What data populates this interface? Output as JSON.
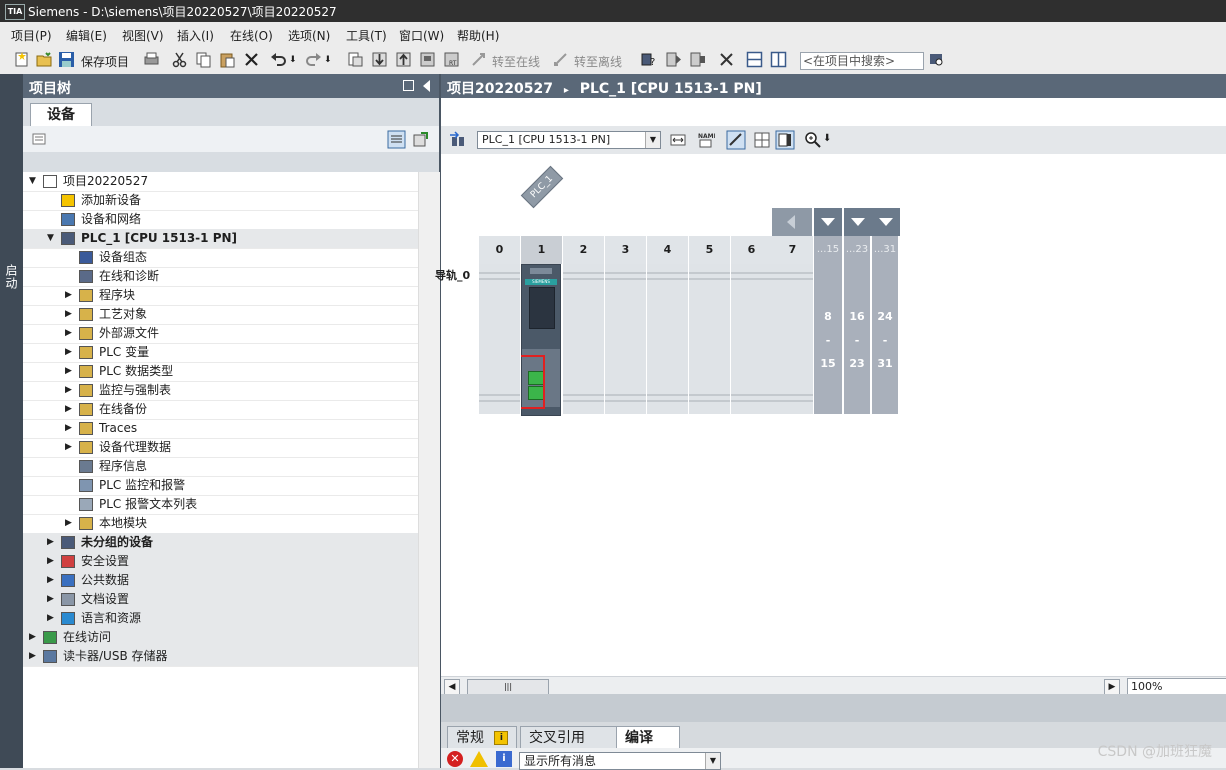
{
  "app": {
    "title": "Siemens  -  D:\\siemens\\项目20220527\\项目20220527",
    "logo": "TIA"
  },
  "menu": [
    "项目(P)",
    "编辑(E)",
    "视图(V)",
    "插入(I)",
    "在线(O)",
    "选项(N)",
    "工具(T)",
    "窗口(W)",
    "帮助(H)"
  ],
  "toolbar": {
    "save_label": "保存项目",
    "go_online": "转至在线",
    "go_offline": "转至离线",
    "search_placeholder": "<在项目中搜索>"
  },
  "startbar": {
    "label": "启动"
  },
  "tree": {
    "header": "项目树",
    "tab": "设备",
    "items": [
      {
        "label": "项目20220527",
        "level": 0,
        "arrow": "down",
        "icon": "document-icon"
      },
      {
        "label": "添加新设备",
        "level": 1,
        "arrow": "",
        "icon": "add-device-icon"
      },
      {
        "label": "设备和网络",
        "level": 1,
        "arrow": "",
        "icon": "network-icon"
      },
      {
        "label": "PLC_1 [CPU 1513-1 PN]",
        "level": 1,
        "arrow": "down",
        "icon": "plc-icon",
        "bold": true,
        "selected": true
      },
      {
        "label": "设备组态",
        "level": 2,
        "arrow": "",
        "icon": "device-config-icon"
      },
      {
        "label": "在线和诊断",
        "level": 2,
        "arrow": "",
        "icon": "diagnostics-icon"
      },
      {
        "label": "程序块",
        "level": 2,
        "arrow": "right",
        "icon": "folder-icon"
      },
      {
        "label": "工艺对象",
        "level": 2,
        "arrow": "right",
        "icon": "folder-icon"
      },
      {
        "label": "外部源文件",
        "level": 2,
        "arrow": "right",
        "icon": "folder-icon"
      },
      {
        "label": "PLC 变量",
        "level": 2,
        "arrow": "right",
        "icon": "folder-icon"
      },
      {
        "label": "PLC 数据类型",
        "level": 2,
        "arrow": "right",
        "icon": "folder-icon"
      },
      {
        "label": "监控与强制表",
        "level": 2,
        "arrow": "right",
        "icon": "folder-icon"
      },
      {
        "label": "在线备份",
        "level": 2,
        "arrow": "right",
        "icon": "folder-icon"
      },
      {
        "label": "Traces",
        "level": 2,
        "arrow": "right",
        "icon": "folder-icon"
      },
      {
        "label": "设备代理数据",
        "level": 2,
        "arrow": "right",
        "icon": "folder-icon"
      },
      {
        "label": "程序信息",
        "level": 2,
        "arrow": "",
        "icon": "program-info-icon"
      },
      {
        "label": "PLC 监控和报警",
        "level": 2,
        "arrow": "",
        "icon": "alarm-icon"
      },
      {
        "label": "PLC 报警文本列表",
        "level": 2,
        "arrow": "",
        "icon": "text-list-icon"
      },
      {
        "label": "本地模块",
        "level": 2,
        "arrow": "right",
        "icon": "folder-icon"
      },
      {
        "label": "未分组的设备",
        "level": 1,
        "arrow": "right",
        "icon": "ungrouped-devices-icon",
        "bold": true
      },
      {
        "label": "安全设置",
        "level": 1,
        "arrow": "right",
        "icon": "security-icon"
      },
      {
        "label": "公共数据",
        "level": 1,
        "arrow": "right",
        "icon": "common-data-icon"
      },
      {
        "label": "文档设置",
        "level": 1,
        "arrow": "right",
        "icon": "doc-settings-icon"
      },
      {
        "label": "语言和资源",
        "level": 1,
        "arrow": "right",
        "icon": "language-icon"
      },
      {
        "label": "在线访问",
        "level": 0,
        "arrow": "right",
        "icon": "online-access-icon"
      },
      {
        "label": "读卡器/USB 存储器",
        "level": 0,
        "arrow": "right",
        "icon": "card-reader-icon"
      }
    ]
  },
  "editor": {
    "breadcrumb_project": "项目20220527",
    "breadcrumb_sep": "▸",
    "breadcrumb_device": "PLC_1 [CPU 1513-1 PN]",
    "device_select": "PLC_1 [CPU 1513-1 PN]",
    "plc_tag": "PLC_1",
    "rail_label": "导轨_0",
    "slots": [
      "0",
      "1",
      "2",
      "3",
      "4",
      "5",
      "6",
      "7"
    ],
    "slot_groups": [
      {
        "head": "...15",
        "from": "8",
        "dash": "-",
        "to": "15"
      },
      {
        "head": "...23",
        "from": "16",
        "dash": "-",
        "to": "23"
      },
      {
        "head": "...31",
        "from": "24",
        "dash": "-",
        "to": "31"
      }
    ],
    "cpu_brand": "SIEMENS",
    "zoom": "100%",
    "scroll_grip": "|||"
  },
  "bottom": {
    "tabs": [
      "常规",
      "交叉引用",
      "编译"
    ],
    "active_tab": "编译",
    "message_filter": "显示所有消息"
  },
  "watermark": "CSDN @加班狂魔",
  "colors": {
    "titlebar": "#2f2f2f",
    "panel_header": "#5a6878",
    "highlight_border": "#e02020",
    "port_green": "#3bb54a",
    "cpu_body": "#4b5968"
  }
}
